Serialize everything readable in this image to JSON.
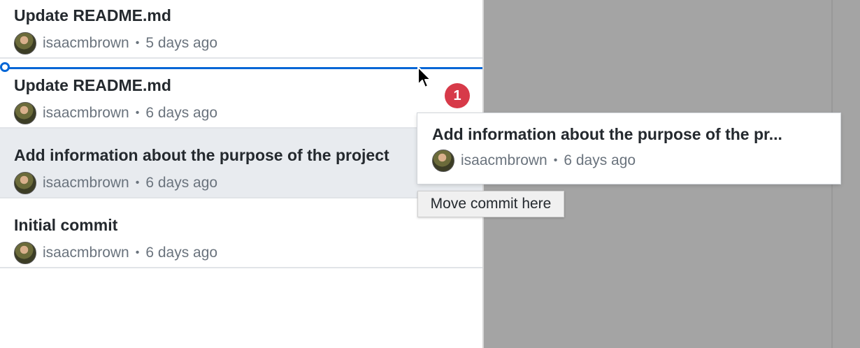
{
  "commits": [
    {
      "title": "Update README.md",
      "author": "isaacmbrown",
      "time": "5 days ago"
    },
    {
      "title": "Update README.md",
      "author": "isaacmbrown",
      "time": "6 days ago"
    },
    {
      "title": "Add information about the purpose of the project",
      "author": "isaacmbrown",
      "time": "6 days ago"
    },
    {
      "title": "Initial commit",
      "author": "isaacmbrown",
      "time": "6 days ago"
    }
  ],
  "separator": "•",
  "drag": {
    "badge_count": "1",
    "title": "Add information about the purpose of the pr...",
    "author": "isaacmbrown",
    "time": "6 days ago",
    "tooltip": "Move commit here"
  },
  "colors": {
    "accent": "#0366d6",
    "badge": "#d73a49",
    "selected_row": "#e8ebef",
    "panel": "#a4a4a4"
  },
  "icons": {
    "cursor": "arrow-cursor-icon",
    "avatar": "user-avatar"
  }
}
